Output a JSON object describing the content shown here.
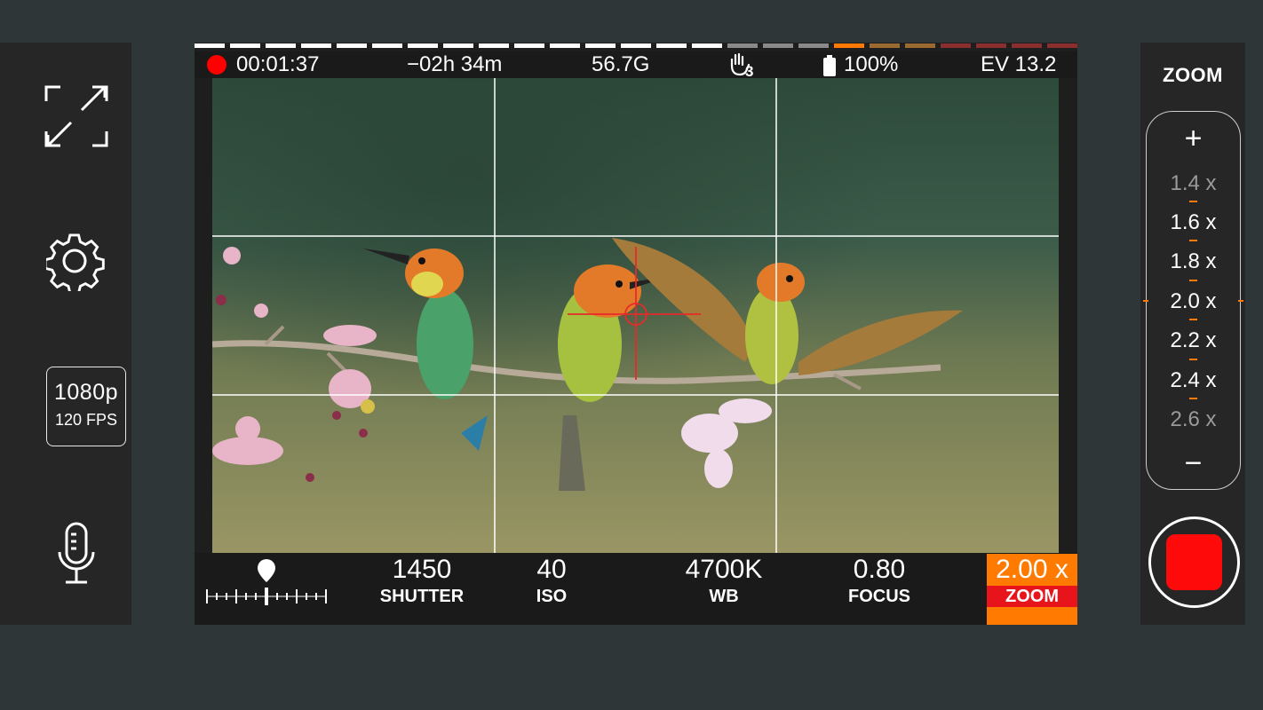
{
  "status": {
    "elapsed": "00:01:37",
    "remaining": "−02h 34m",
    "storage": "56.7G",
    "hand_count": "3",
    "battery": "100%",
    "ev": "EV 13.2"
  },
  "left_panel": {
    "resolution": "1080p",
    "fps": "120 FPS",
    "icons": [
      "expand-icon",
      "settings-gear-icon",
      "microphone-icon"
    ]
  },
  "bottom_params": {
    "shutter": {
      "value": "1450",
      "label": "SHUTTER"
    },
    "iso": {
      "value": "40",
      "label": "ISO"
    },
    "wb": {
      "value": "4700K",
      "label": "WB"
    },
    "focus": {
      "value": "0.80",
      "label": "FOCUS"
    },
    "zoom": {
      "value": "2.00 x",
      "label": "ZOOM"
    }
  },
  "zoom_panel": {
    "title": "ZOOM",
    "plus": "+",
    "minus": "−",
    "steps": [
      "1.4 x",
      "1.6 x",
      "1.8 x",
      "2.0 x",
      "2.2 x",
      "2.4 x",
      "2.6 x"
    ]
  },
  "colors": {
    "record_red": "#ff0a0a",
    "accent_orange": "#ff7a00",
    "zoom_label_red": "#e8141c"
  }
}
